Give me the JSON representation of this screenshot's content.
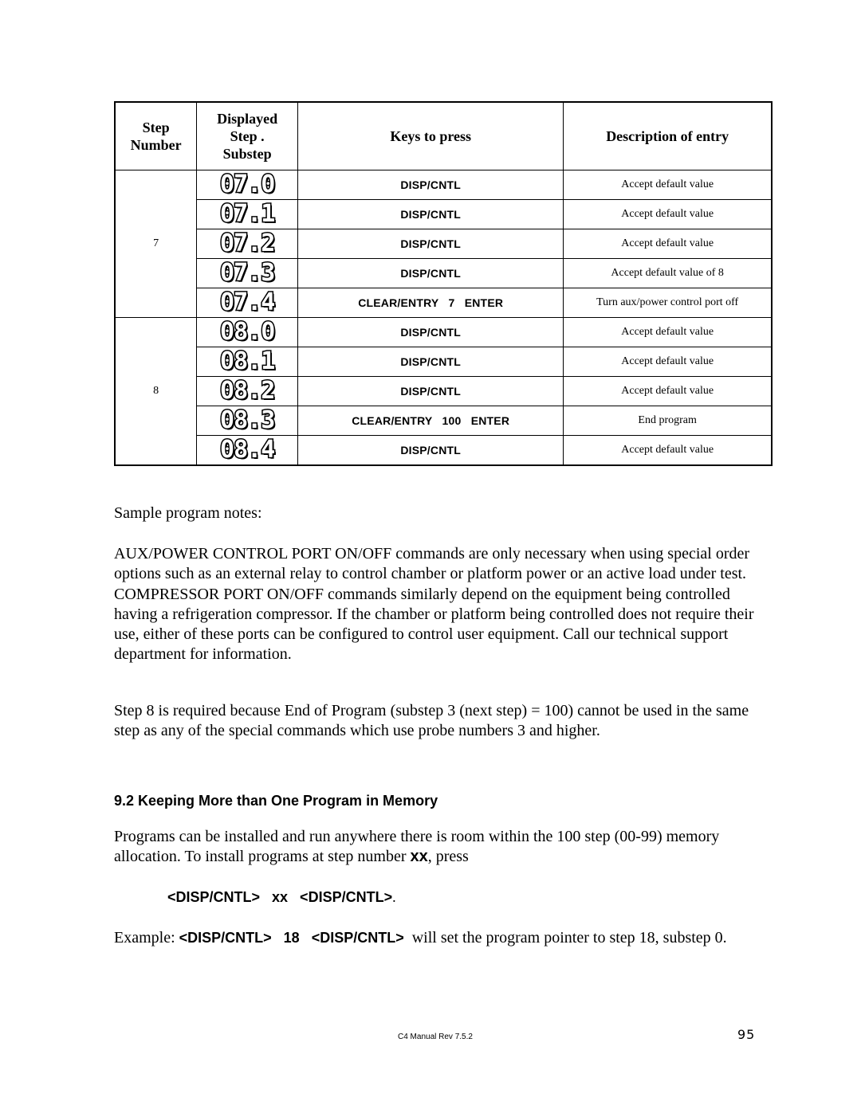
{
  "table": {
    "headers": {
      "step_number": "Step\nNumber",
      "step_number_lines": [
        "Step",
        "Number"
      ],
      "displayed_lines": [
        "Displayed",
        "Step .",
        "Substep"
      ],
      "keys": "Keys to press",
      "description": "Description of entry"
    },
    "groups": [
      {
        "step": "7",
        "rows": [
          {
            "display": "07.0",
            "keys": "DISP/CNTL",
            "description": "Accept default value"
          },
          {
            "display": "07.1",
            "keys": "DISP/CNTL",
            "description": "Accept default value"
          },
          {
            "display": "07.2",
            "keys": "DISP/CNTL",
            "description": "Accept default value"
          },
          {
            "display": "07.3",
            "keys": "DISP/CNTL",
            "description": "Accept default value of 8"
          },
          {
            "display": "07.4",
            "keys": "CLEAR/ENTRY   7   ENTER",
            "description": "Turn aux/power control port off"
          }
        ]
      },
      {
        "step": "8",
        "rows": [
          {
            "display": "08.0",
            "keys": "DISP/CNTL",
            "description": "Accept default value"
          },
          {
            "display": "08.1",
            "keys": "DISP/CNTL",
            "description": "Accept default value"
          },
          {
            "display": "08.2",
            "keys": "DISP/CNTL",
            "description": "Accept default value"
          },
          {
            "display": "08.3",
            "keys": "CLEAR/ENTRY   100   ENTER",
            "description": "End program"
          },
          {
            "display": "08.4",
            "keys": "DISP/CNTL",
            "description": "Accept default value"
          }
        ]
      }
    ]
  },
  "notes_title": "Sample program notes:",
  "paragraph_aux": "AUX/POWER CONTROL PORT ON/OFF commands are only necessary when using special order options such as an external relay to control chamber or platform power or an active load under test.  COMPRESSOR PORT ON/OFF commands similarly depend on the equipment being controlled having a refrigeration compressor.  If the chamber or platform being controlled does not require their use, either of these ports can be configured to control user equipment.  Call our technical support department for information.",
  "paragraph_step8": "Step 8 is required because End of Program (substep 3 (next step) = 100) cannot be used in the same step as any of the special commands which use probe numbers 3 and higher.",
  "section_heading": "9.2  Keeping More than One Program in Memory",
  "paragraph_programs": {
    "before": "Programs can be installed and run anywhere there is room within the 100 step (00-99) memory allocation.  To install programs at step number ",
    "bold": "xx",
    "after": ", press"
  },
  "command_line": {
    "text": "<DISP/CNTL>   xx   <DISP/CNTL>",
    "suffix": "."
  },
  "example": {
    "lead": "Example:  ",
    "command": "<DISP/CNTL>   18   <DISP/CNTL>",
    "tail": "  will set the program pointer to step 18, substep 0."
  },
  "footer": {
    "doc_rev": "C4 Manual Rev 7.5.2",
    "page_number": "95"
  }
}
